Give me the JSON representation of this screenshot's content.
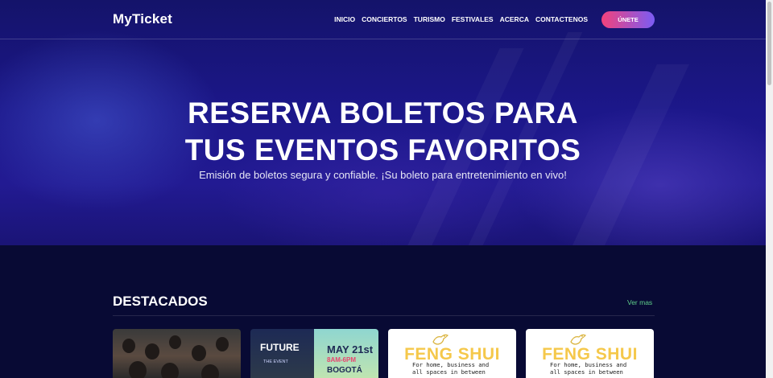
{
  "brand": "MyTicket",
  "nav": {
    "items": [
      "INICIO",
      "CONCIERTOS",
      "TURISMO",
      "FESTIVALES",
      "ACERCA",
      "CONTACTENOS"
    ],
    "cta": "ÚNETE"
  },
  "hero": {
    "line1": "RESERVA BOLETOS PARA",
    "line2": "TUS EVENTOS FAVORITOS",
    "subtitle": "Emisión de boletos segura y confiable. ¡Su boleto para entretenimiento en vivo!"
  },
  "featured": {
    "title": "DESTACADOS",
    "more": "Ver mas",
    "cards": [
      {
        "alt": "crowd-photo"
      },
      {
        "future": "FUTURE",
        "event": "THE EVENT",
        "date": "MAY 21st",
        "time": "8AM-6PM",
        "city": "BOGOTÁ"
      },
      {
        "title": "FENG SHUI",
        "line1": "For home, business and",
        "line2": "all spaces in between"
      },
      {
        "title": "FENG SHUI",
        "line1": "For home, business and",
        "line2": "all spaces in between"
      }
    ]
  },
  "colors": {
    "accent_start": "#f2427c",
    "accent_end": "#7a5cf4",
    "link": "#5fcf8a",
    "background": "#080a34"
  }
}
